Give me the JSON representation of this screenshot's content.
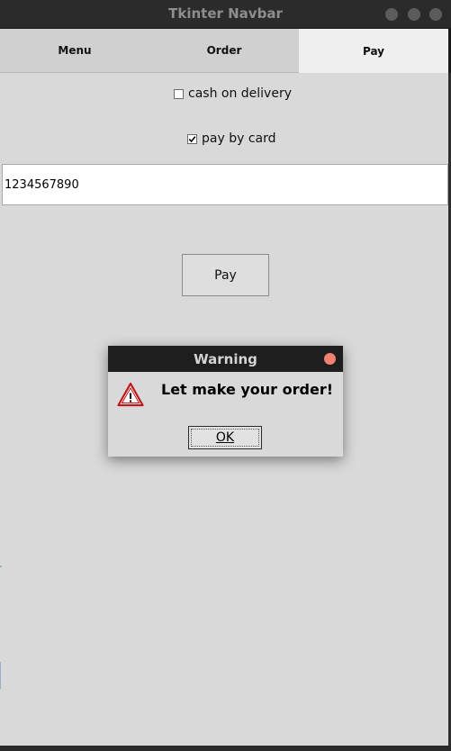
{
  "window": {
    "title": "Tkinter Navbar"
  },
  "tabs": [
    {
      "label": "Menu",
      "active": false
    },
    {
      "label": "Order",
      "active": false
    },
    {
      "label": "Pay",
      "active": true
    }
  ],
  "payment": {
    "cash_label": "cash on delivery",
    "cash_checked": false,
    "card_label": "pay by card",
    "card_checked": true,
    "card_number": "1234567890",
    "pay_button": "Pay"
  },
  "dialog": {
    "title": "Warning",
    "message": "Let make your order!",
    "ok_label": "OK",
    "icon": "warning-triangle-icon"
  },
  "colors": {
    "background": "#d9d9d9",
    "titlebar": "#2b2b2b",
    "dialog_close": "#f08272"
  }
}
